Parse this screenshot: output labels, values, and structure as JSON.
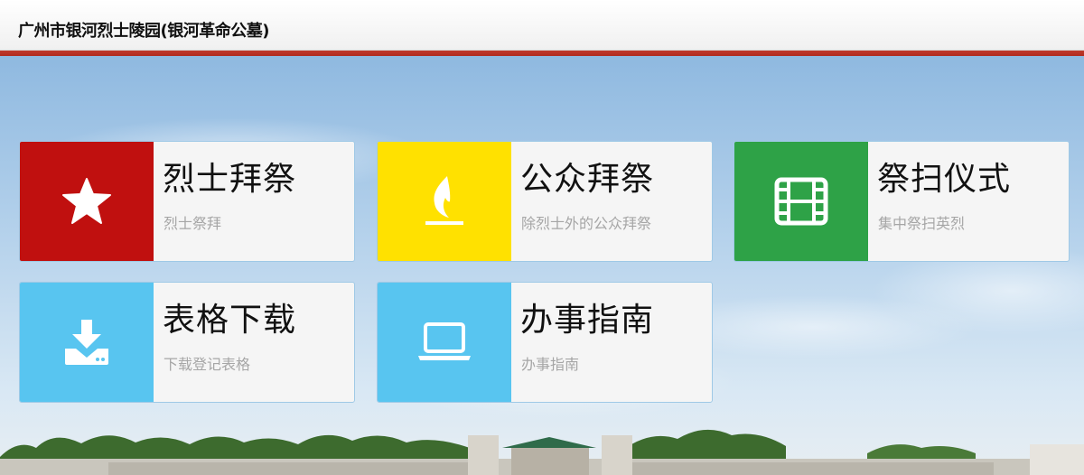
{
  "header": {
    "title": "广州市银河烈士陵园(银河革命公墓)"
  },
  "colors": {
    "header_bar": "#c0392b",
    "tile_red": "#c0100f",
    "tile_yellow": "#ffe100",
    "tile_green": "#2ea247",
    "tile_blue": "#58c5f0"
  },
  "tiles": [
    {
      "title": "烈士拜祭",
      "subtitle": "烈士祭拜",
      "icon": "star-icon"
    },
    {
      "title": "公众拜祭",
      "subtitle": "除烈士外的公众拜祭",
      "icon": "flame-icon"
    },
    {
      "title": "祭扫仪式",
      "subtitle": "集中祭扫英烈",
      "icon": "film-icon"
    },
    {
      "title": "表格下载",
      "subtitle": "下载登记表格",
      "icon": "download-icon"
    },
    {
      "title": "办事指南",
      "subtitle": "办事指南",
      "icon": "laptop-icon"
    }
  ]
}
